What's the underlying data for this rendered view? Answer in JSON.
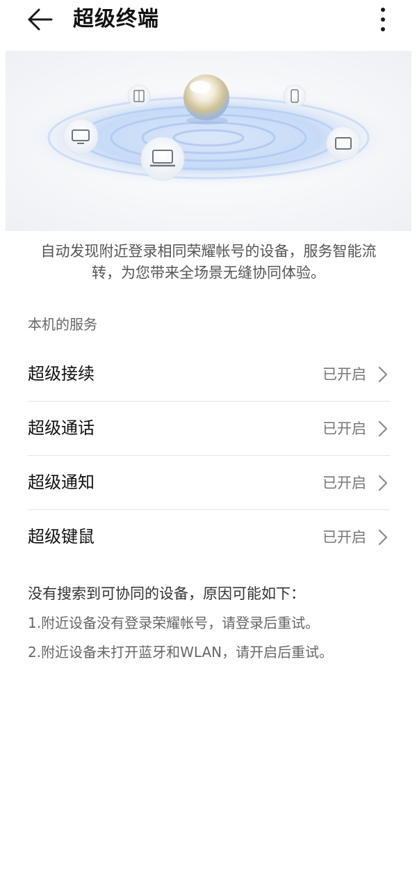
{
  "header": {
    "title": "超级终端",
    "back_icon": "arrow-left-icon",
    "more_icon": "more-vertical-icon"
  },
  "banner": {
    "icons": [
      "book-icon",
      "phone-icon",
      "tv-icon",
      "laptop-icon",
      "tablet-icon",
      "orb-icon"
    ]
  },
  "intro": "自动发现附近登录相同荣耀帐号的设备，服务智能流转，为您带来全场景无缝协同体验。",
  "services": {
    "section_label": "本机的服务",
    "items": [
      {
        "title": "超级接续",
        "status": "已开启"
      },
      {
        "title": "超级通话",
        "status": "已开启"
      },
      {
        "title": "超级通知",
        "status": "已开启"
      },
      {
        "title": "超级键鼠",
        "status": "已开启"
      }
    ]
  },
  "notes": {
    "title": "没有搜索到可协同的设备，原因可能如下：",
    "lines": [
      "1.附近设备没有登录荣耀帐号，请登录后重试。",
      "2.附近设备未打开蓝牙和WLAN，请开启后重试。"
    ]
  },
  "colors": {
    "background": "#ffffff",
    "ripple": "#bcd4f5",
    "divider": "#e3e3e3"
  }
}
